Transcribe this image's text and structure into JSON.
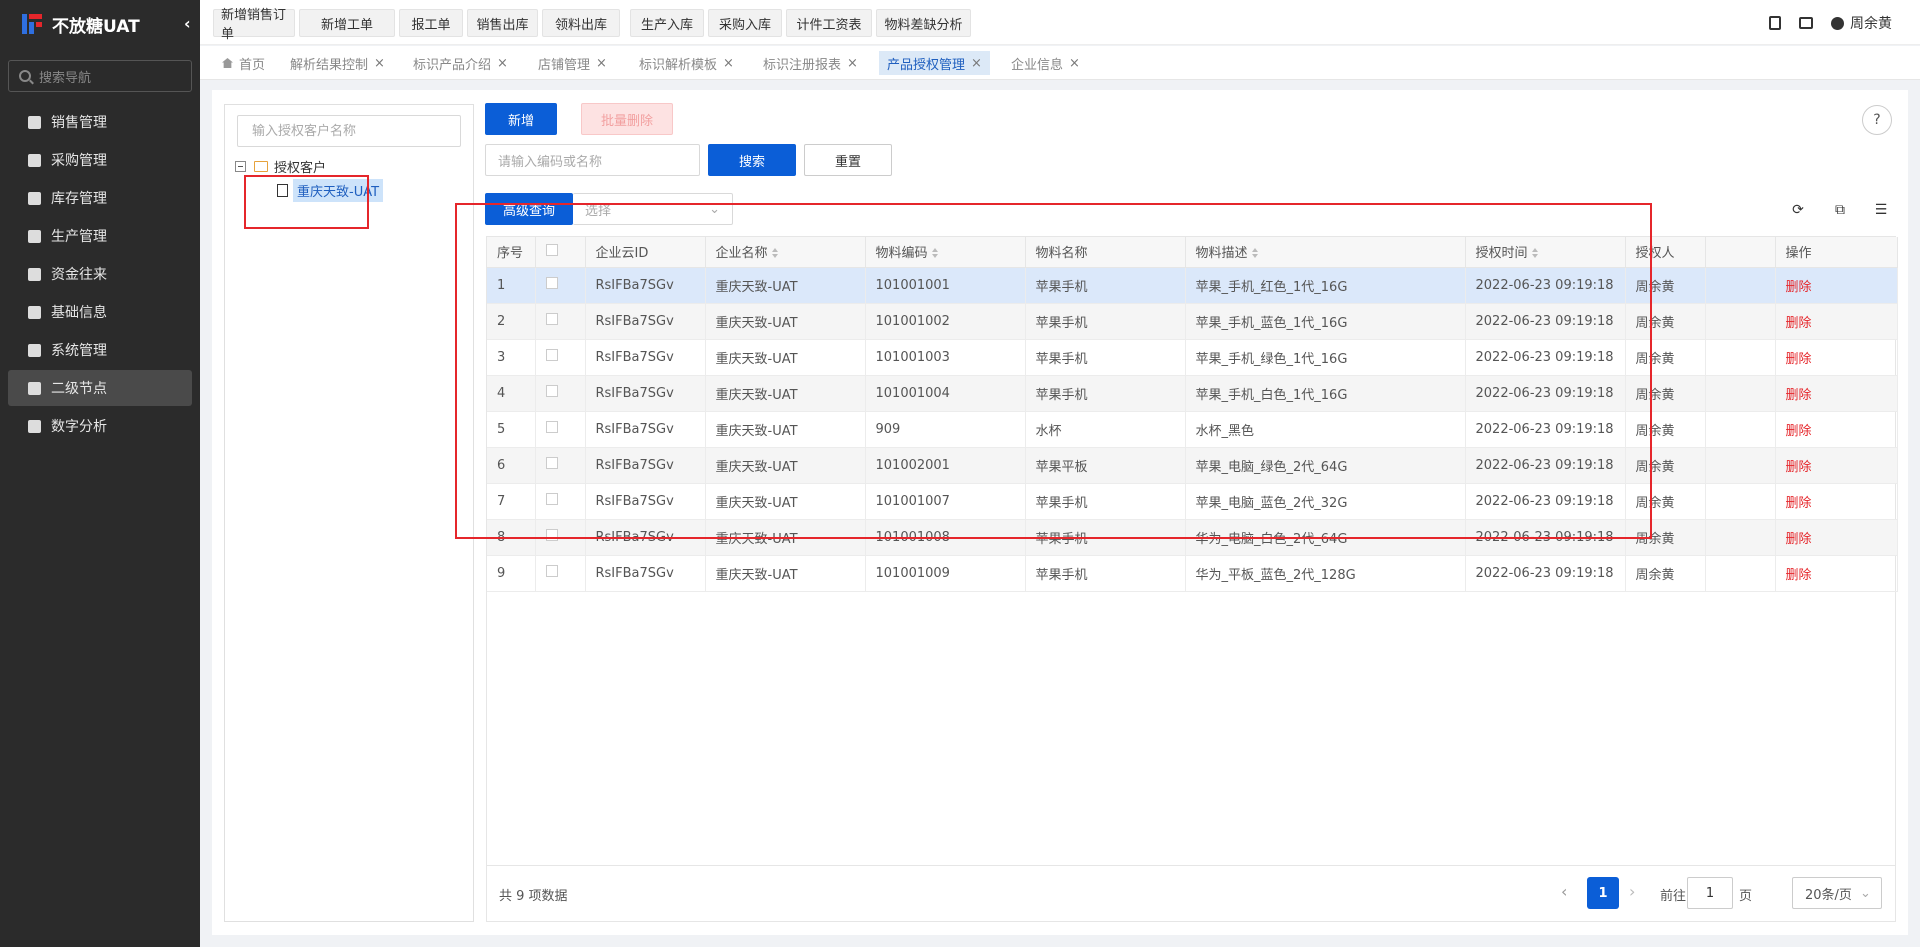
{
  "app": {
    "title": "不放糖UAT"
  },
  "sidebar": {
    "search_placeholder": "搜索导航",
    "items": [
      {
        "label": "销售管理",
        "icon": "tag-icon"
      },
      {
        "label": "采购管理",
        "icon": "cart-icon"
      },
      {
        "label": "库存管理",
        "icon": "warehouse-icon"
      },
      {
        "label": "生产管理",
        "icon": "factory-icon"
      },
      {
        "label": "资金往来",
        "icon": "money-icon"
      },
      {
        "label": "基础信息",
        "icon": "grid-icon"
      },
      {
        "label": "系统管理",
        "icon": "apps-icon"
      },
      {
        "label": "二级节点",
        "icon": "doc-icon"
      },
      {
        "label": "数字分析",
        "icon": "pie-icon"
      }
    ]
  },
  "quick_actions": [
    "新增销售订单",
    "新增工单",
    "报工单",
    "销售出库",
    "领料出库",
    "生产入库",
    "采购入库",
    "计件工资表",
    "物料差缺分析"
  ],
  "user": {
    "name": "周余黄"
  },
  "tabs": [
    {
      "label": "首页"
    },
    {
      "label": "解析结果控制"
    },
    {
      "label": "标识产品介绍"
    },
    {
      "label": "店铺管理"
    },
    {
      "label": "标识解析模板"
    },
    {
      "label": "标识注册报表"
    },
    {
      "label": "产品授权管理"
    },
    {
      "label": "企业信息"
    }
  ],
  "tree": {
    "search_placeholder": "输入授权客户名称",
    "root_label": "授权客户",
    "child_label": "重庆天致-UAT"
  },
  "toolbar": {
    "add_label": "新增",
    "batch_delete_label": "批量删除",
    "search_placeholder": "请输入编码或名称",
    "search_label": "搜索",
    "reset_label": "重置",
    "advanced_label": "高级查询",
    "select_placeholder": "选择",
    "help": "?"
  },
  "table": {
    "columns": [
      "序号",
      "",
      "企业云ID",
      "企业名称",
      "物料编码",
      "物料名称",
      "物料描述",
      "授权时间",
      "授权人",
      "",
      "操作"
    ],
    "rows": [
      {
        "idx": "1",
        "cloud_id": "RsIFBa7SGv",
        "company": "重庆天致-UAT",
        "code": "101001001",
        "name": "苹果手机",
        "desc": "苹果_手机_红色_1代_16G",
        "time": "2022-06-23 09:19:18",
        "user": "周余黄",
        "op": "删除"
      },
      {
        "idx": "2",
        "cloud_id": "RsIFBa7SGv",
        "company": "重庆天致-UAT",
        "code": "101001002",
        "name": "苹果手机",
        "desc": "苹果_手机_蓝色_1代_16G",
        "time": "2022-06-23 09:19:18",
        "user": "周余黄",
        "op": "删除"
      },
      {
        "idx": "3",
        "cloud_id": "RsIFBa7SGv",
        "company": "重庆天致-UAT",
        "code": "101001003",
        "name": "苹果手机",
        "desc": "苹果_手机_绿色_1代_16G",
        "time": "2022-06-23 09:19:18",
        "user": "周余黄",
        "op": "删除"
      },
      {
        "idx": "4",
        "cloud_id": "RsIFBa7SGv",
        "company": "重庆天致-UAT",
        "code": "101001004",
        "name": "苹果手机",
        "desc": "苹果_手机_白色_1代_16G",
        "time": "2022-06-23 09:19:18",
        "user": "周余黄",
        "op": "删除"
      },
      {
        "idx": "5",
        "cloud_id": "RsIFBa7SGv",
        "company": "重庆天致-UAT",
        "code": "909",
        "name": "水杯",
        "desc": "水杯_黑色",
        "time": "2022-06-23 09:19:18",
        "user": "周余黄",
        "op": "删除"
      },
      {
        "idx": "6",
        "cloud_id": "RsIFBa7SGv",
        "company": "重庆天致-UAT",
        "code": "101002001",
        "name": "苹果平板",
        "desc": "苹果_电脑_绿色_2代_64G",
        "time": "2022-06-23 09:19:18",
        "user": "周余黄",
        "op": "删除"
      },
      {
        "idx": "7",
        "cloud_id": "RsIFBa7SGv",
        "company": "重庆天致-UAT",
        "code": "101001007",
        "name": "苹果手机",
        "desc": "苹果_电脑_蓝色_2代_32G",
        "time": "2022-06-23 09:19:18",
        "user": "周余黄",
        "op": "删除"
      },
      {
        "idx": "8",
        "cloud_id": "RsIFBa7SGv",
        "company": "重庆天致-UAT",
        "code": "101001008",
        "name": "苹果手机",
        "desc": "华为_电脑_白色_2代_64G",
        "time": "2022-06-23 09:19:18",
        "user": "周余黄",
        "op": "删除"
      },
      {
        "idx": "9",
        "cloud_id": "RsIFBa7SGv",
        "company": "重庆天致-UAT",
        "code": "101001009",
        "name": "苹果手机",
        "desc": "华为_平板_蓝色_2代_128G",
        "time": "2022-06-23 09:19:18",
        "user": "周余黄",
        "op": "删除"
      }
    ]
  },
  "pagination": {
    "total_text": "共 9 项数据",
    "current": "1",
    "goto_label": "前往",
    "goto_value": "1",
    "page_unit": "页",
    "page_size": "20条/页"
  },
  "colors": {
    "primary": "#0b5ed7",
    "danger": "#e5262b",
    "sidebar_bg": "#2b2b2b"
  }
}
